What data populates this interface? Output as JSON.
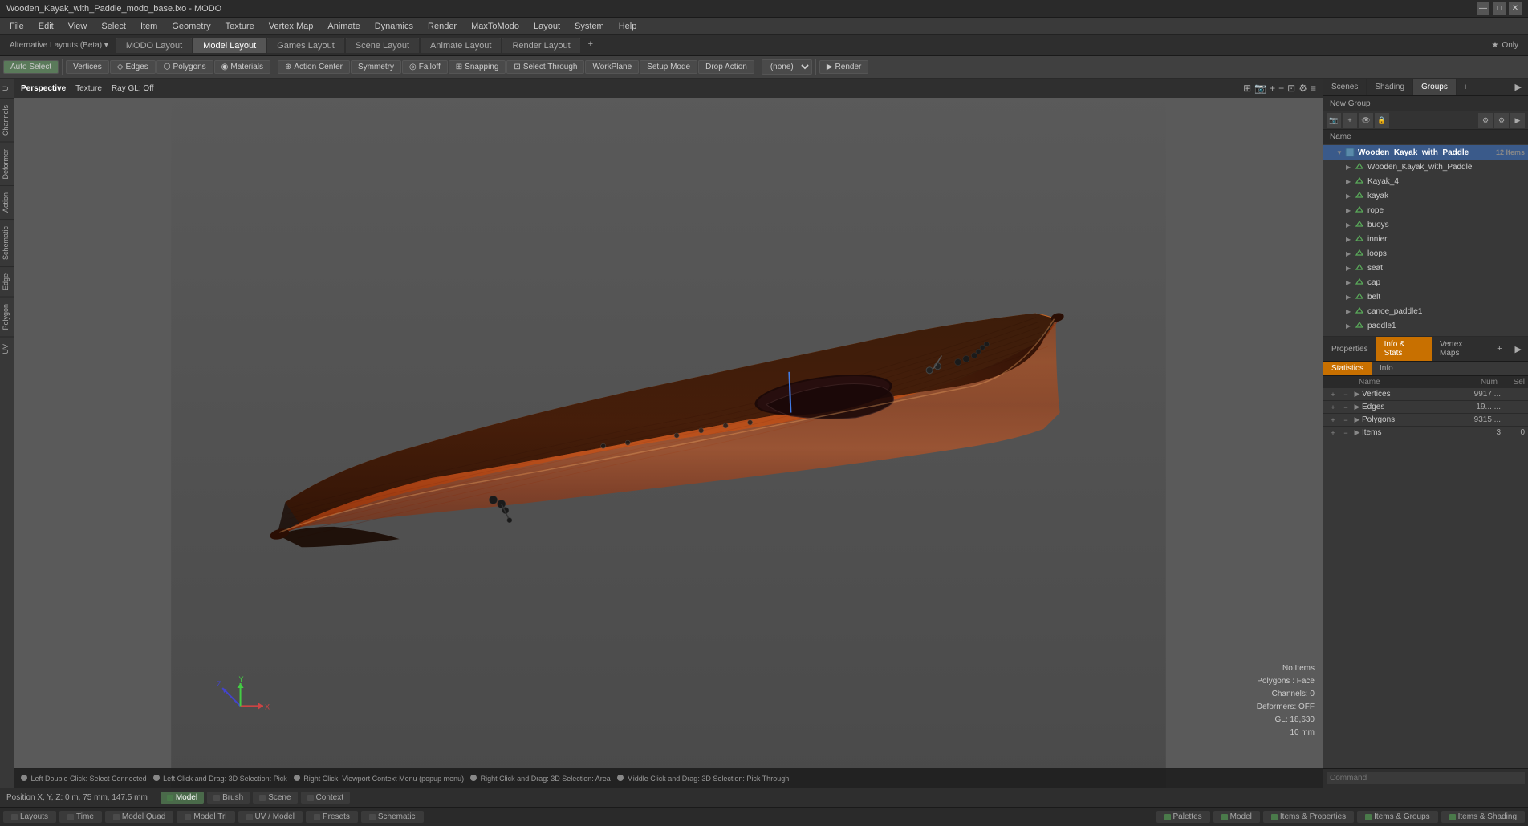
{
  "window": {
    "title": "Wooden_Kayak_with_Paddle_modo_base.lxo - MODO"
  },
  "titlebar": {
    "title": "Wooden_Kayak_with_Paddle_modo_base.lxo - MODO",
    "minimize_label": "—",
    "maximize_label": "□",
    "close_label": "✕"
  },
  "menubar": {
    "items": [
      "File",
      "Edit",
      "View",
      "Select",
      "Item",
      "Geometry",
      "Texture",
      "Vertex Map",
      "Animate",
      "Dynamics",
      "Render",
      "MaxToModo",
      "Layout",
      "System",
      "Help"
    ]
  },
  "layout_tabs": {
    "input_label": "Alternative Layouts (Beta)",
    "tabs": [
      "MODO Layout",
      "Model Layout",
      "Games Layout",
      "Scene Layout",
      "Animate Layout",
      "Render Layout"
    ],
    "active": "Model Layout",
    "add_label": "+",
    "star_label": "★ Only"
  },
  "toolbar": {
    "auto_select": "Auto Select",
    "vertices": "Vertices",
    "edges": "Edges",
    "polygons": "Polygons",
    "materials": "Materials",
    "action_center": "Action Center",
    "symmetry": "Symmetry",
    "falloff": "Falloff",
    "snapping": "Snapping",
    "select_through": "Select Through",
    "workplane": "WorkPlane",
    "setup_mode": "Setup Mode",
    "drop_action": "Drop Action",
    "none_dropdown": "(none)",
    "render_btn": "Render"
  },
  "viewport": {
    "header": {
      "perspective": "Perspective",
      "texture": "Texture",
      "ray_gl": "Ray GL: Off"
    },
    "info": {
      "no_items": "No Items",
      "polygons_face": "Polygons : Face",
      "channels": "Channels: 0",
      "deformers": "Deformers: OFF",
      "gl": "GL: 18,630",
      "unit": "10 mm"
    },
    "bottom_info": {
      "left_double_click": "Left Double Click: Select Connected",
      "left_drag": "Left Click and Drag: 3D Selection: Pick",
      "right_click": "Right Click: Viewport Context Menu (popup menu)",
      "right_drag": "Right Click and Drag: 3D Selection: Area",
      "middle_click": "Middle Click and Drag: 3D Selection: Pick Through"
    }
  },
  "left_tabs": {
    "items": [
      "U",
      "Channels",
      "Deformer",
      "Action",
      "Schematic",
      "Edge",
      "Polygon",
      "UV"
    ]
  },
  "right_panel": {
    "tabs": {
      "items": [
        "Scenes",
        "Shading",
        "Groups"
      ],
      "active": "Groups",
      "add_label": "+"
    },
    "new_group_label": "New Group",
    "name_col": "Name",
    "scene_tree": {
      "root": {
        "label": "Wooden_Kayak_with_Paddle",
        "count": "12 Items",
        "expanded": true
      },
      "items": [
        {
          "label": "Wooden_Kayak_with_Paddle",
          "indent": 1,
          "type": "mesh"
        },
        {
          "label": "Kayak_4",
          "indent": 1,
          "type": "mesh"
        },
        {
          "label": "kayak",
          "indent": 1,
          "type": "mesh"
        },
        {
          "label": "rope",
          "indent": 1,
          "type": "mesh"
        },
        {
          "label": "buoys",
          "indent": 1,
          "type": "mesh"
        },
        {
          "label": "innier",
          "indent": 1,
          "type": "mesh"
        },
        {
          "label": "loops",
          "indent": 1,
          "type": "mesh"
        },
        {
          "label": "seat",
          "indent": 1,
          "type": "mesh"
        },
        {
          "label": "cap",
          "indent": 1,
          "type": "mesh"
        },
        {
          "label": "belt",
          "indent": 1,
          "type": "mesh"
        },
        {
          "label": "canoe_paddle1",
          "indent": 1,
          "type": "mesh"
        },
        {
          "label": "paddle1",
          "indent": 1,
          "type": "mesh"
        }
      ]
    }
  },
  "stats_panel": {
    "tabs": [
      "Properties",
      "Info & Stats",
      "Vertex Maps"
    ],
    "active_tab": "Info & Stats",
    "sub_tabs": [
      "Statistics",
      "Info"
    ],
    "active_sub": "Statistics",
    "cols": {
      "name": "Name",
      "num": "Num",
      "sel": "Sel"
    },
    "rows": [
      {
        "label": "Vertices",
        "num": "9917 ...",
        "sel": ""
      },
      {
        "label": "Edges",
        "num": "19... ...",
        "sel": ""
      },
      {
        "label": "Polygons",
        "num": "9315 ...",
        "sel": ""
      },
      {
        "label": "Items",
        "num": "3",
        "sel": "0"
      }
    ]
  },
  "command_bar": {
    "label": "Command",
    "placeholder": "Command"
  },
  "statusbar": {
    "position": "Position X, Y, Z:  0 m, 75 mm, 147.5 mm",
    "tabs": [
      {
        "label": "Model",
        "color": "#4a7a4a",
        "active": true
      },
      {
        "label": "Brush",
        "color": "#4a4a4a"
      },
      {
        "label": "Scene",
        "color": "#4a4a4a"
      },
      {
        "label": "Context",
        "color": "#4a4a4a"
      }
    ]
  },
  "bottombar": {
    "buttons": [
      {
        "label": "Layouts"
      },
      {
        "label": "Time"
      },
      {
        "label": "Model Quad"
      },
      {
        "label": "Model Tri"
      },
      {
        "label": "UV / Model"
      },
      {
        "label": "Presets"
      },
      {
        "label": "Schematic"
      }
    ],
    "right_buttons": [
      {
        "label": "Palettes"
      },
      {
        "label": "Model"
      },
      {
        "label": "Items & Properties"
      },
      {
        "label": "Items & Groups"
      },
      {
        "label": "Items & Shading"
      }
    ]
  }
}
